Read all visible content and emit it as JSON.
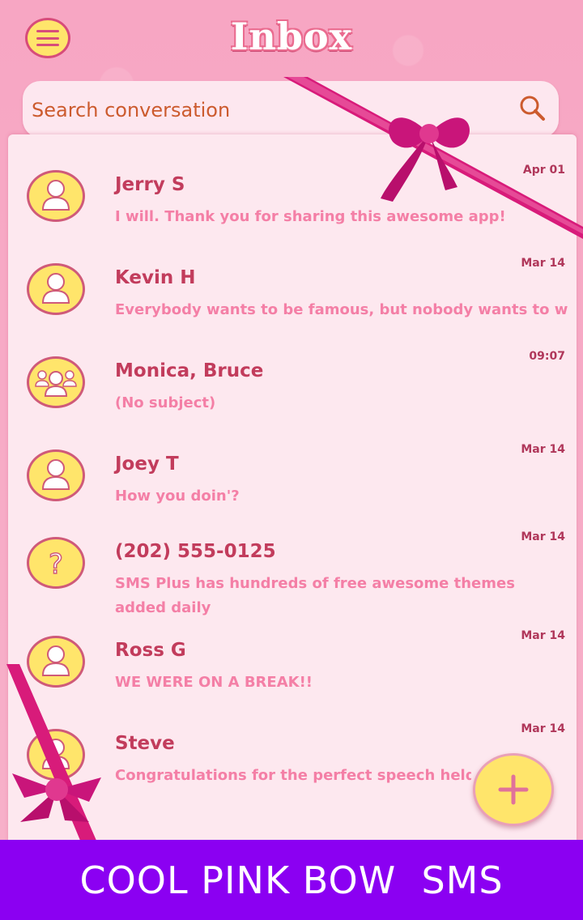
{
  "header": {
    "title": "Inbox",
    "menu_icon": "hamburger-menu-icon"
  },
  "search": {
    "placeholder": "Search conversation",
    "icon": "search-icon"
  },
  "conversations": [
    {
      "name": "Jerry S",
      "preview": "I will. Thank you for sharing this awesome app!",
      "date": "Apr 01",
      "avatar": "person-icon"
    },
    {
      "name": "Kevin H",
      "preview": "Everybody wants to be famous, but nobody wants to work",
      "date": "Mar 14",
      "avatar": "person-icon"
    },
    {
      "name": "Monica, Bruce",
      "preview": "(No subject)",
      "date": "09:07",
      "avatar": "group-icon"
    },
    {
      "name": "Joey T",
      "preview": "How you doin'?",
      "date": "Mar 14",
      "avatar": "person-icon"
    },
    {
      "name": "(202) 555-0125",
      "preview": "SMS Plus has hundreds of free awesome themes added daily",
      "date": "Mar 14",
      "avatar": "question-icon"
    },
    {
      "name": "Ross G",
      "preview": "WE WERE ON A BREAK!!",
      "date": "Mar 14",
      "avatar": "person-icon"
    },
    {
      "name": "Steve",
      "preview": "Congratulations for the perfect speech held today",
      "date": "Mar 14",
      "avatar": "person-icon"
    }
  ],
  "fab": {
    "icon": "plus-icon"
  },
  "banner": {
    "text": "COOL PINK BOW  SMS"
  },
  "colors": {
    "accent_yellow": "#ffe56b",
    "name_pink": "#c23c5c",
    "preview_pink": "#f47fa6",
    "banner_purple": "#8b00f2"
  }
}
